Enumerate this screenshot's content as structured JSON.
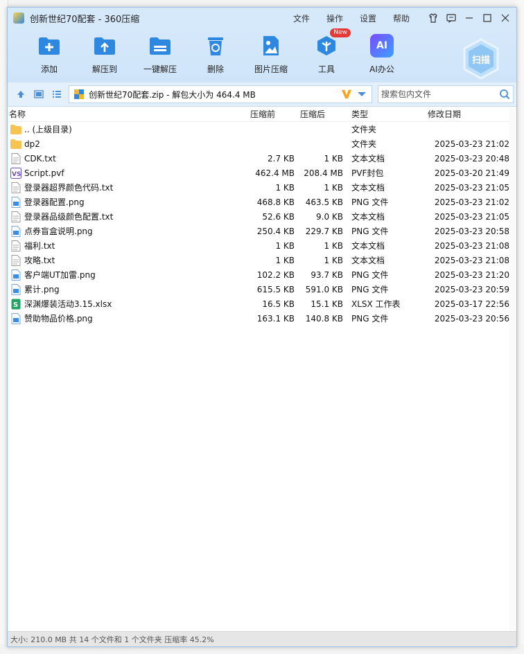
{
  "window": {
    "title": "创新世纪70配套 - 360压缩",
    "menu": [
      "文件",
      "操作",
      "设置",
      "帮助"
    ]
  },
  "toolbar": {
    "items": [
      {
        "label": "添加",
        "icon": "add-icon"
      },
      {
        "label": "解压到",
        "icon": "extract-to-icon"
      },
      {
        "label": "一键解压",
        "icon": "one-click-extract-icon"
      },
      {
        "label": "删除",
        "icon": "delete-icon"
      },
      {
        "label": "图片压缩",
        "icon": "image-compress-icon"
      },
      {
        "label": "工具",
        "icon": "tools-icon",
        "badge": "New"
      },
      {
        "label": "AI办公",
        "icon": "ai-office-icon",
        "icon_text": "AI"
      }
    ],
    "scan_label": "扫描"
  },
  "address": {
    "path": "创新世纪70配套.zip - 解包大小为 464.4 MB",
    "search_placeholder": "搜索包内文件"
  },
  "columns": {
    "name": "名称",
    "size": "压缩前",
    "packed": "压缩后",
    "type": "类型",
    "date": "修改日期"
  },
  "files": [
    {
      "name": ".. (上级目录)",
      "size": "",
      "packed": "",
      "type": "文件夹",
      "date": "",
      "icon": "folder-icon"
    },
    {
      "name": "dp2",
      "size": "",
      "packed": "",
      "type": "文件夹",
      "date": "2025-03-23 21:02",
      "icon": "folder-icon"
    },
    {
      "name": "CDK.txt",
      "size": "2.7 KB",
      "packed": "1 KB",
      "type": "文本文档",
      "date": "2025-03-23 20:48",
      "icon": "txt-file-icon"
    },
    {
      "name": "Script.pvf",
      "size": "462.4 MB",
      "packed": "208.4 MB",
      "type": "PVF封包",
      "date": "2025-03-20 21:49",
      "icon": "pvf-file-icon"
    },
    {
      "name": "登录器超界颜色代码.txt",
      "size": "1 KB",
      "packed": "1 KB",
      "type": "文本文档",
      "date": "2025-03-23 21:05",
      "icon": "txt-file-icon"
    },
    {
      "name": "登录器配置.png",
      "size": "468.8 KB",
      "packed": "463.5 KB",
      "type": "PNG 文件",
      "date": "2025-03-23 21:02",
      "icon": "png-file-icon"
    },
    {
      "name": "登录器品级颜色配置.txt",
      "size": "52.6 KB",
      "packed": "9.0 KB",
      "type": "文本文档",
      "date": "2025-03-23 21:05",
      "icon": "txt-file-icon"
    },
    {
      "name": "点券盲盒说明.png",
      "size": "250.4 KB",
      "packed": "229.7 KB",
      "type": "PNG 文件",
      "date": "2025-03-23 20:58",
      "icon": "png-file-icon"
    },
    {
      "name": "福利.txt",
      "size": "1 KB",
      "packed": "1 KB",
      "type": "文本文档",
      "date": "2025-03-23 21:08",
      "icon": "txt-file-icon"
    },
    {
      "name": "攻略.txt",
      "size": "1 KB",
      "packed": "1 KB",
      "type": "文本文档",
      "date": "2025-03-23 21:08",
      "icon": "txt-file-icon"
    },
    {
      "name": "客户端UT加雷.png",
      "size": "102.2 KB",
      "packed": "93.7 KB",
      "type": "PNG 文件",
      "date": "2025-03-23 21:20",
      "icon": "png-file-icon"
    },
    {
      "name": "累计.png",
      "size": "615.5 KB",
      "packed": "591.0 KB",
      "type": "PNG 文件",
      "date": "2025-03-23 20:59",
      "icon": "png-file-icon"
    },
    {
      "name": "深渊爆装活动3.15.xlsx",
      "size": "16.5 KB",
      "packed": "15.1 KB",
      "type": "XLSX 工作表",
      "date": "2025-03-17 22:56",
      "icon": "xlsx-file-icon"
    },
    {
      "name": "赞助物品价格.png",
      "size": "163.1 KB",
      "packed": "140.8 KB",
      "type": "PNG 文件",
      "date": "2025-03-23 20:56",
      "icon": "png-file-icon"
    }
  ],
  "status": "大小: 210.0 MB 共 14 个文件和 1 个文件夹 压缩率 45.2%",
  "colors": {
    "titlebar": "#d6e9fb",
    "accent": "#2f88e0",
    "folder": "#f5c451",
    "new_badge": "#e53935"
  }
}
